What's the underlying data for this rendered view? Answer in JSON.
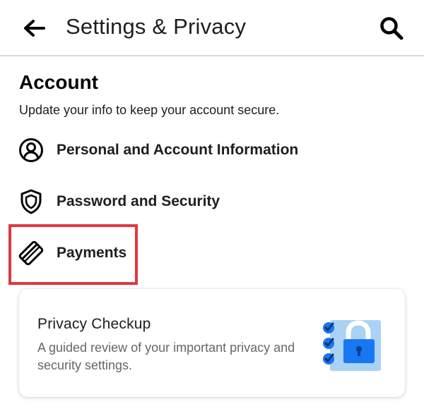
{
  "header": {
    "back_icon": "arrow-left-icon",
    "title": "Settings & Privacy",
    "search_icon": "search-icon"
  },
  "account": {
    "title": "Account",
    "subtitle": "Update your info to keep your account secure.",
    "items": [
      {
        "label": "Personal and Account Information",
        "icon": "person-circle-icon"
      },
      {
        "label": "Password and Security",
        "icon": "shield-icon"
      },
      {
        "label": "Payments",
        "icon": "credit-card-icon",
        "highlighted": true
      }
    ]
  },
  "privacy_card": {
    "title": "Privacy Checkup",
    "description": "A guided review of your important privacy and security settings.",
    "illustration": "lock-checklist-icon"
  },
  "colors": {
    "highlight_border": "#e0383e",
    "accent_blue": "#1877f2",
    "illustration_bg": "#a9d2f5"
  }
}
